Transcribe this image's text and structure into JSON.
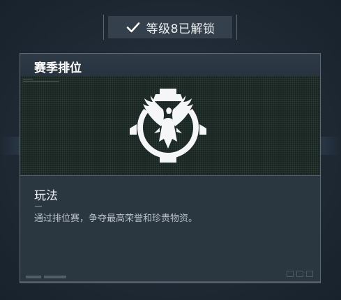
{
  "unlock_banner": {
    "icon": "checkmark-icon",
    "text": "等级8已解锁"
  },
  "card": {
    "title": "赛季排位",
    "emblem": "eagle-emblem-icon",
    "info": {
      "heading": "玩法",
      "description": "通过排位赛，争夺最高荣誉和珍贵物资。"
    }
  },
  "colors": {
    "background": "#1f2a35",
    "panel": "#243039",
    "border": "#5e6b77",
    "text": "#eef2f5"
  }
}
